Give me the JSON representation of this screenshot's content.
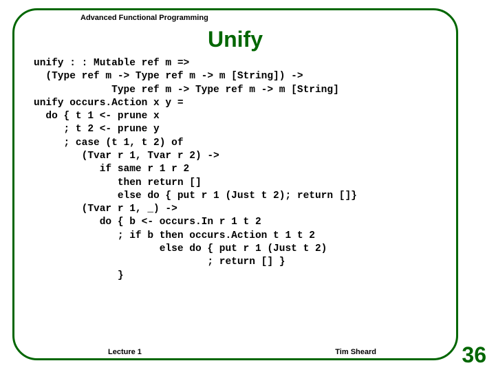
{
  "header": "Advanced Functional Programming",
  "title": "Unify",
  "code": "unify : : Mutable ref m =>\n  (Type ref m -> Type ref m -> m [String]) ->\n             Type ref m -> Type ref m -> m [String]\nunify occurs.Action x y =\n  do { t 1 <- prune x\n     ; t 2 <- prune y\n     ; case (t 1, t 2) of\n        (Tvar r 1, Tvar r 2) ->\n           if same r 1 r 2\n              then return []\n              else do { put r 1 (Just t 2); return []}\n        (Tvar r 1, _) ->\n           do { b <- occurs.In r 1 t 2\n              ; if b then occurs.Action t 1 t 2\n                     else do { put r 1 (Just t 2)\n                             ; return [] }\n              }",
  "footer_left": "Lecture 1",
  "footer_right": "Tim Sheard",
  "page_number": "36"
}
